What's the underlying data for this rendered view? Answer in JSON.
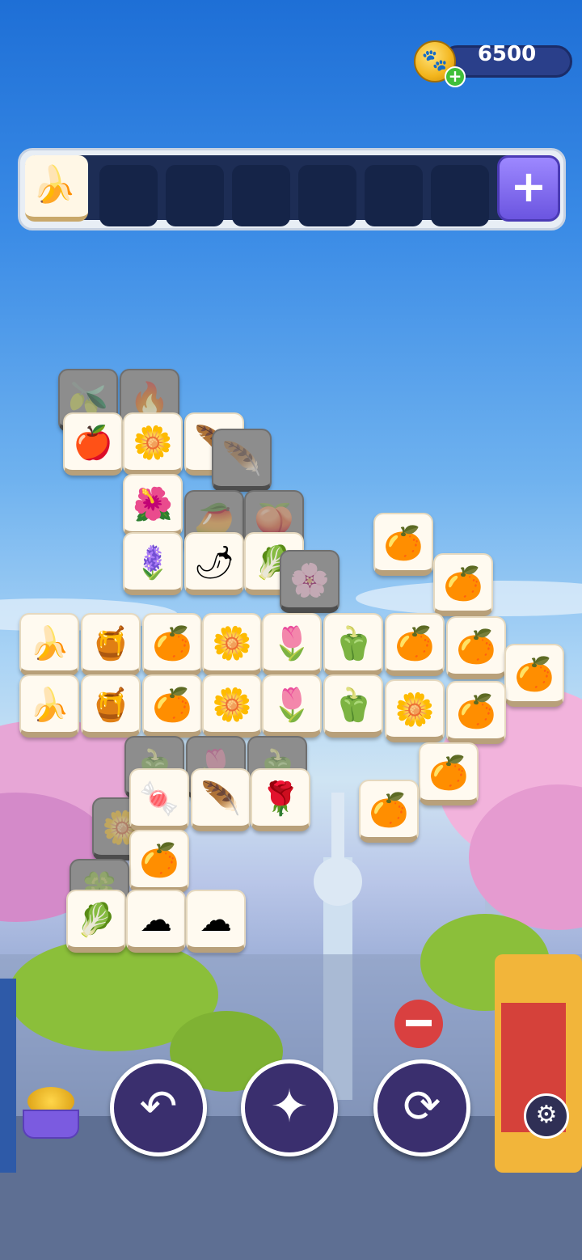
{
  "hud": {
    "coin_count": "6500",
    "coin_icon": "paw-coin-icon",
    "add_coins_icon": "plus-icon"
  },
  "tray": {
    "slots": [
      "🍌",
      "",
      "",
      "",
      "",
      "",
      ""
    ],
    "add_slot_label": "+"
  },
  "tiles": [
    {
      "glyph": "🫒",
      "state": "dim"
    },
    {
      "glyph": "🔥",
      "state": "dim"
    },
    {
      "glyph": "🍎",
      "state": "active"
    },
    {
      "glyph": "🌼",
      "state": "active"
    },
    {
      "glyph": "🪶",
      "state": "active"
    },
    {
      "glyph": "🪶",
      "state": "dim"
    },
    {
      "glyph": "🌺",
      "state": "active"
    },
    {
      "glyph": "🥭",
      "state": "dim"
    },
    {
      "glyph": "🍑",
      "state": "dim"
    },
    {
      "glyph": "🪻",
      "state": "active"
    },
    {
      "glyph": "🌶",
      "state": "active"
    },
    {
      "glyph": "🥬",
      "state": "active"
    },
    {
      "glyph": "🌸",
      "state": "dim"
    },
    {
      "glyph": "🍊",
      "state": "active"
    },
    {
      "glyph": "🍊",
      "state": "active"
    },
    {
      "glyph": "🍌",
      "state": "active"
    },
    {
      "glyph": "🍯",
      "state": "active"
    },
    {
      "glyph": "🍊",
      "state": "active"
    },
    {
      "glyph": "🌼",
      "state": "active"
    },
    {
      "glyph": "🌷",
      "state": "active"
    },
    {
      "glyph": "🫑",
      "state": "active"
    },
    {
      "glyph": "🍊",
      "state": "active"
    },
    {
      "glyph": "🍊",
      "state": "active"
    },
    {
      "glyph": "🍊",
      "state": "active"
    },
    {
      "glyph": "🍌",
      "state": "active"
    },
    {
      "glyph": "🍯",
      "state": "active"
    },
    {
      "glyph": "🍊",
      "state": "active"
    },
    {
      "glyph": "🌼",
      "state": "active"
    },
    {
      "glyph": "🌷",
      "state": "active"
    },
    {
      "glyph": "🫑",
      "state": "active"
    },
    {
      "glyph": "🌼",
      "state": "active"
    },
    {
      "glyph": "🍊",
      "state": "active"
    },
    {
      "glyph": "🫑",
      "state": "dim"
    },
    {
      "glyph": "🌷",
      "state": "dim"
    },
    {
      "glyph": "🫑",
      "state": "dim"
    },
    {
      "glyph": "🍊",
      "state": "active"
    },
    {
      "glyph": "🌼",
      "state": "dim"
    },
    {
      "glyph": "🍬",
      "state": "active"
    },
    {
      "glyph": "🪶",
      "state": "active"
    },
    {
      "glyph": "🌹",
      "state": "active"
    },
    {
      "glyph": "🍊",
      "state": "active"
    },
    {
      "glyph": "🍊",
      "state": "active"
    },
    {
      "glyph": "🍀",
      "state": "dim"
    },
    {
      "glyph": "🥬",
      "state": "active"
    },
    {
      "glyph": "☁",
      "state": "active"
    },
    {
      "glyph": "☁",
      "state": "active"
    }
  ],
  "controls": {
    "undo_icon": "undo-arrow-icon",
    "undo_glyph": "↶",
    "magic_icon": "magic-wand-icon",
    "magic_glyph": "✦",
    "shuffle_icon": "shuffle-icon",
    "shuffle_glyph": "⟳",
    "settings_glyph": "⚙"
  }
}
